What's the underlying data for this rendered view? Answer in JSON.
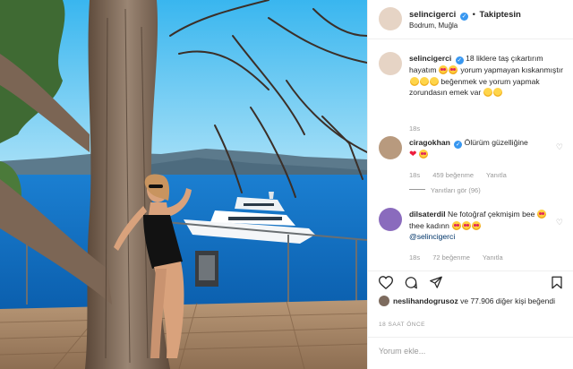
{
  "post": {
    "username": "selincigerci",
    "follow_status": "Takiptesin",
    "location": "Bodrum, Muğla"
  },
  "caption": {
    "username": "selincigerci",
    "text_1": "18 liklere taş çıkartırım hayatım",
    "text_2": "yorum yapmayan kıskanmıştır",
    "text_3": "beğenmek ve yorum yapmak zorundasın emek var",
    "age": "18s"
  },
  "comments": [
    {
      "username": "ciragokhan",
      "text": "Ölürüm güzelliğine",
      "age": "18s",
      "likes": "459 beğenme",
      "reply": "Yanıtla",
      "view_replies": "Yanıtları gör (96)"
    },
    {
      "username": "dilsaterdil",
      "text_1": "Ne fotoğraf çekmişim bee",
      "text_2": "thee kadınn",
      "mention": "@selincigerci",
      "age": "18s",
      "likes": "72 beğenme",
      "reply": "Yanıtla"
    }
  ],
  "likes": {
    "user": "neslihandogrusoz",
    "text": "ve 77.906 diğer kişi beğendi"
  },
  "timestamp": "18 SAAT ÖNCE",
  "comment_input": {
    "placeholder": "Yorum ekle..."
  },
  "icons": [
    "heart-icon",
    "comment-icon",
    "share-icon",
    "bookmark-icon",
    "verified-badge-icon"
  ],
  "colors": {
    "verified": "#3897f0",
    "sky": "#4fc3f7",
    "sea": "#1e88d6"
  }
}
